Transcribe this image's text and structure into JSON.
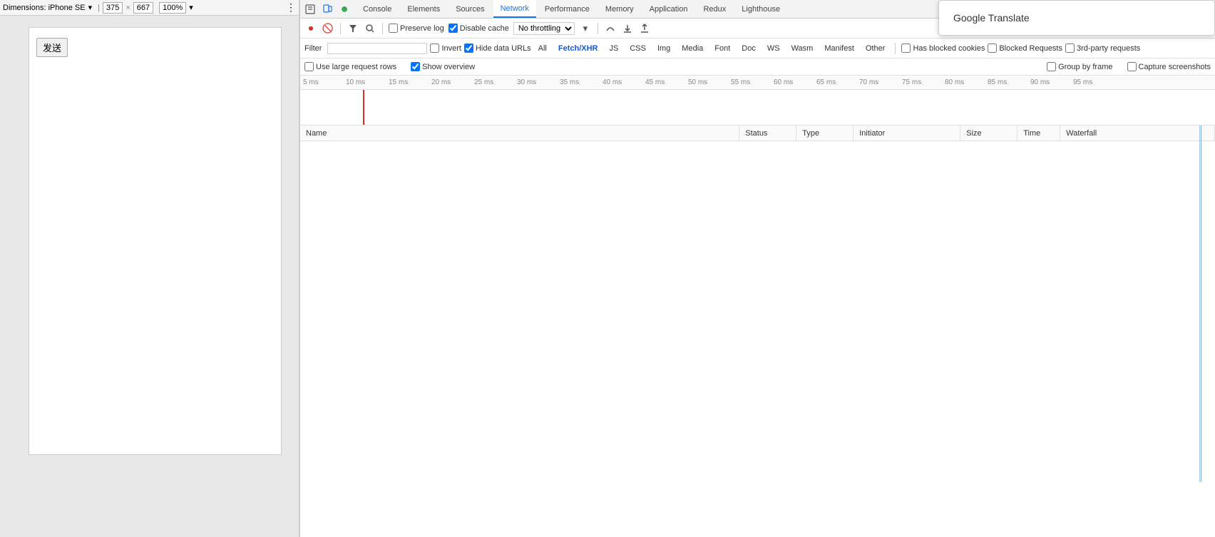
{
  "browser": {
    "device_name": "Dimensions: iPhone SE",
    "width": "375",
    "height": "667",
    "zoom": "100%",
    "send_button_label": "发送"
  },
  "devtools": {
    "tabs": [
      {
        "id": "console",
        "label": "Console",
        "active": false
      },
      {
        "id": "elements",
        "label": "Elements",
        "active": false
      },
      {
        "id": "sources",
        "label": "Sources",
        "active": false
      },
      {
        "id": "network",
        "label": "Network",
        "active": true
      },
      {
        "id": "performance",
        "label": "Performance",
        "active": false
      },
      {
        "id": "memory",
        "label": "Memory",
        "active": false
      },
      {
        "id": "application",
        "label": "Application",
        "active": false
      },
      {
        "id": "redux",
        "label": "Redux",
        "active": false
      },
      {
        "id": "lighthouse",
        "label": "Lighthouse",
        "active": false
      }
    ],
    "toolbar": {
      "preserve_log_label": "Preserve log",
      "disable_cache_label": "Disable cache",
      "throttle_value": "No throttling",
      "preserve_log_checked": false,
      "disable_cache_checked": true
    },
    "filter_row": {
      "filter_label": "Filter",
      "invert_label": "Invert",
      "hide_data_urls_label": "Hide data URLs",
      "type_filters": [
        "All",
        "Fetch/XHR",
        "JS",
        "CSS",
        "Img",
        "Media",
        "Font",
        "Doc",
        "WS",
        "Wasm",
        "Manifest",
        "Other"
      ],
      "active_type": "Fetch/XHR",
      "has_blocked_cookies_label": "Has blocked cookies",
      "blocked_requests_label": "Blocked Requests",
      "third_party_requests_label": "3rd-party requests"
    },
    "options_row": {
      "use_large_request_rows_label": "Use large request rows",
      "show_overview_label": "Show overview",
      "group_by_frame_label": "Group by frame",
      "capture_screenshots_label": "Capture screenshots",
      "show_overview_checked": true,
      "use_large_request_rows_checked": false,
      "group_by_frame_checked": false,
      "capture_screenshots_checked": false
    },
    "timeline": {
      "ticks": [
        "5 ms",
        "10 ms",
        "15 ms",
        "20 ms",
        "25 ms",
        "30 ms",
        "35 ms",
        "40 ms",
        "45 ms",
        "50 ms",
        "55 ms",
        "60 ms",
        "65 ms",
        "70 ms",
        "75 ms",
        "80 ms",
        "85 ms",
        "90 ms",
        "95 ms"
      ]
    },
    "table": {
      "columns": [
        {
          "id": "name",
          "label": "Name"
        },
        {
          "id": "status",
          "label": "Status"
        },
        {
          "id": "type",
          "label": "Type"
        },
        {
          "id": "initiator",
          "label": "Initiator"
        },
        {
          "id": "size",
          "label": "Size"
        },
        {
          "id": "time",
          "label": "Time"
        },
        {
          "id": "waterfall",
          "label": "Waterfall"
        }
      ],
      "rows": []
    }
  },
  "google_translate": {
    "title": "Google Translate"
  }
}
